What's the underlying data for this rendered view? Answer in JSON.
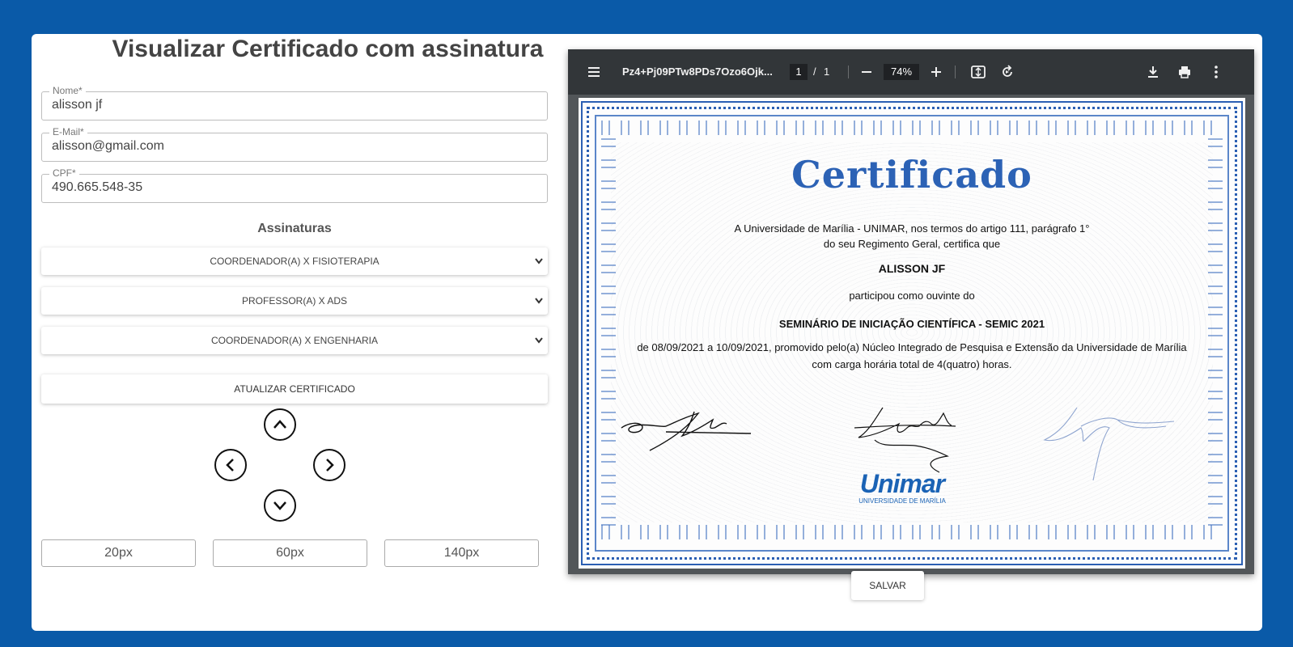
{
  "page": {
    "title": "Visualizar Certificado com assinatura"
  },
  "form": {
    "name": {
      "label": "Nome*",
      "value": "alisson jf"
    },
    "email": {
      "label": "E-Mail*",
      "value": "alisson@gmail.com"
    },
    "cpf": {
      "label": "CPF*",
      "value": "490.665.548-35"
    }
  },
  "signatures": {
    "title": "Assinaturas",
    "selects": [
      {
        "value": "COORDENADOR(A) X FISIOTERAPIA"
      },
      {
        "value": "PROFESSOR(A) X ADS"
      },
      {
        "value": "COORDENADOR(A) X ENGENHARIA"
      }
    ],
    "update_label": "ATUALIZAR CERTIFICADO"
  },
  "position_controls": {
    "icons": [
      "chevron-up-icon",
      "chevron-left-icon",
      "chevron-right-icon",
      "chevron-down-icon"
    ],
    "sizes": [
      "20px",
      "60px",
      "140px"
    ]
  },
  "viewer": {
    "filename": "Pz4+Pj09PTw8PDs7Ozo6Ojk...",
    "current_page": "1",
    "page_separator": "/",
    "total_pages": "1",
    "zoom": "74%",
    "icons": [
      "menu-icon",
      "zoom-out-icon",
      "zoom-in-icon",
      "fit-page-icon",
      "rotate-icon",
      "download-icon",
      "print-icon",
      "more-icon"
    ]
  },
  "certificate": {
    "title": "Certificado",
    "line1": "A Universidade de Marília - UNIMAR, nos termos do artigo 111, parágrafo 1°",
    "line2": "do seu Regimento Geral, certifica que",
    "recipient": "ALISSON JF",
    "participation": "participou como ouvinte do",
    "event": "SEMINÁRIO DE INICIAÇÃO CIENTÍFICA - SEMIC 2021",
    "details1": "de 08/09/2021 a 10/09/2021, promovido pelo(a) Núcleo Integrado de Pesquisa e Extensão da Universidade de Marília",
    "details2": "com carga horária total de 4(quatro) horas.",
    "logo_main": "Unimar",
    "logo_sub": "UNIVERSIDADE DE MARÍLIA"
  },
  "actions": {
    "save_label": "SALVAR"
  },
  "colors": {
    "background": "#0a5aa8",
    "certificate_accent": "#2c62b5",
    "viewer_toolbar": "#323639"
  }
}
